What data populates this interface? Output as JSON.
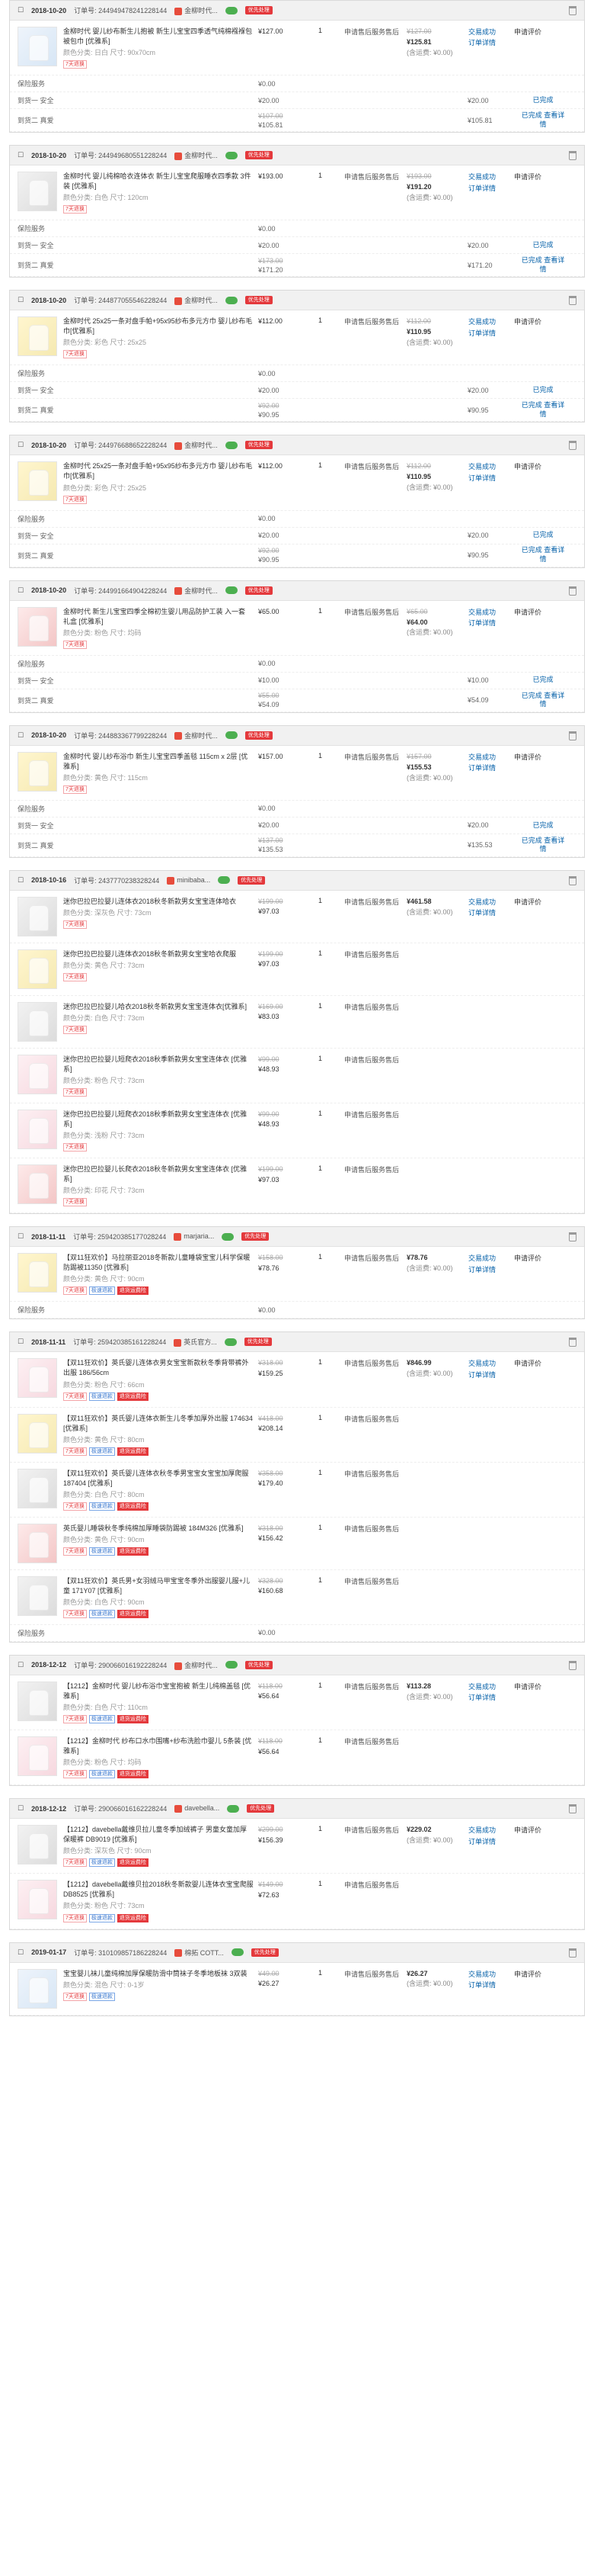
{
  "labels": {
    "order_no": "订单号:",
    "shop": "金柳时代...",
    "service": "服务售后",
    "apply": "申请售后",
    "urgent": "优先处理",
    "trade_done": "交易成功",
    "order_detail": "订单详情",
    "review": "申请评价",
    "closed": "已完成",
    "view_detail": "查看详情",
    "total_prefix": "含运费: ¥0.00",
    "seal": "保险服务",
    "dismiss1": "到货一  安全",
    "dismiss2": "到货二  真爱"
  },
  "orders": [
    {
      "date": "2018-10-20",
      "no": "2449494782412281​44",
      "shop": "金柳时代...",
      "items": [
        {
          "title": "金柳时代 婴儿纱布新生儿抱被 新生儿宝宝四季透气纯棉襁褓包被包巾 [优雅系]",
          "spec": "颜色分类: 日白 尺寸: 90x70cm",
          "price": "¥127.00",
          "qty": "1",
          "pay_strike": "¥127.00",
          "pay": "¥125.81",
          "note": "(含运费: ¥0.00)",
          "thumb": "blue"
        }
      ],
      "summary": [
        {
          "label": "保险服务",
          "amt": "¥0.00",
          "right": ""
        },
        {
          "label": "到货一 安全",
          "amt": "¥20.00",
          "right": "¥20.00",
          "x": "已完成"
        },
        {
          "label": "到货二 真爱",
          "amt": "¥105.81",
          "amt_strike": "¥107.00",
          "right": "¥105.81",
          "x": "已完成 查看详情"
        }
      ]
    },
    {
      "date": "2018-10-20",
      "no": "244949680551228244",
      "shop": "金柳时代...",
      "items": [
        {
          "title": "金柳时代 婴儿纯棉哈衣连体衣 新生儿宝宝爬服睡衣四季款 3件装 [优雅系]",
          "spec": "颜色分类: 白色 尺寸: 120cm",
          "price": "¥193.00",
          "qty": "1",
          "pay_strike": "¥193.00",
          "pay": "¥191.20",
          "note": "(含运费: ¥0.00)",
          "thumb": "grey"
        }
      ],
      "summary": [
        {
          "label": "保险服务",
          "amt": "¥0.00",
          "right": ""
        },
        {
          "label": "到货一 安全",
          "amt": "¥20.00",
          "right": "¥20.00",
          "x": "已完成"
        },
        {
          "label": "到货二 真爱",
          "amt": "¥171.20",
          "amt_strike": "¥173.00",
          "right": "¥171.20",
          "x": "已完成 查看详情"
        }
      ]
    },
    {
      "date": "2018-10-20",
      "no": "244877055546228244",
      "shop": "金柳时代...",
      "items": [
        {
          "title": "金柳时代 25x25一条对盘手帕+95x95纱布多元方巾 婴儿纱布毛巾[优雅系]",
          "spec": "颜色分类: 彩色 尺寸: 25x25",
          "price": "¥112.00",
          "qty": "1",
          "pay_strike": "¥112.00",
          "pay": "¥110.95",
          "note": "(含运费: ¥0.00)",
          "thumb": "yellow"
        }
      ],
      "summary": [
        {
          "label": "保险服务",
          "amt": "¥0.00",
          "right": ""
        },
        {
          "label": "到货一 安全",
          "amt": "¥20.00",
          "right": "¥20.00",
          "x": "已完成"
        },
        {
          "label": "到货二 真爱",
          "amt": "¥90.95",
          "amt_strike": "¥92.00",
          "right": "¥90.95",
          "x": "已完成 查看详情"
        }
      ]
    },
    {
      "date": "2018-10-20",
      "no": "244976688652228244",
      "shop": "金柳时代...",
      "items": [
        {
          "title": "金柳时代 25x25一条对盘手帕+95x95纱布多元方巾 婴儿纱布毛巾[优雅系]",
          "spec": "颜色分类: 彩色 尺寸: 25x25",
          "price": "¥112.00",
          "qty": "1",
          "pay_strike": "¥112.00",
          "pay": "¥110.95",
          "note": "(含运费: ¥0.00)",
          "thumb": "yellow"
        }
      ],
      "summary": [
        {
          "label": "保险服务",
          "amt": "¥0.00",
          "right": ""
        },
        {
          "label": "到货一 安全",
          "amt": "¥20.00",
          "right": "¥20.00",
          "x": "已完成"
        },
        {
          "label": "到货二 真爱",
          "amt": "¥90.95",
          "amt_strike": "¥92.00",
          "right": "¥90.95",
          "x": "已完成 查看详情"
        }
      ]
    },
    {
      "date": "2018-10-20",
      "no": "244991664904228244",
      "shop": "金柳时代...",
      "items": [
        {
          "title": "金柳时代 新生儿宝宝四季全棉初生婴儿用品防护工装 入一套 礼盒 [优雅系]",
          "spec": "颜色分类: 粉色 尺寸: 均码",
          "price": "¥65.00",
          "qty": "1",
          "pay_strike": "¥65.00",
          "pay": "¥64.00",
          "note": "(含运费: ¥0.00)",
          "thumb": "red"
        }
      ],
      "summary": [
        {
          "label": "保险服务",
          "amt": "¥0.00",
          "right": ""
        },
        {
          "label": "到货一 安全",
          "amt": "¥10.00",
          "right": "¥10.00",
          "x": "已完成"
        },
        {
          "label": "到货二 真爱",
          "amt": "¥54.09",
          "amt_strike": "¥55.00",
          "right": "¥54.09",
          "x": "已完成 查看详情"
        }
      ]
    },
    {
      "date": "2018-10-20",
      "no": "244883367799228244",
      "shop": "金柳时代...",
      "items": [
        {
          "title": "金柳时代 婴儿纱布浴巾 新生儿宝宝四季盖毯 115cm x 2层 [优雅系]",
          "spec": "颜色分类: 黄色 尺寸: 115cm",
          "price": "¥157.00",
          "qty": "1",
          "pay_strike": "¥157.00",
          "pay": "¥155.53",
          "note": "(含运费: ¥0.00)",
          "thumb": "yellow"
        }
      ],
      "summary": [
        {
          "label": "保险服务",
          "amt": "¥0.00",
          "right": ""
        },
        {
          "label": "到货一 安全",
          "amt": "¥20.00",
          "right": "¥20.00",
          "x": "已完成"
        },
        {
          "label": "到货二 真爱",
          "amt": "¥135.53",
          "amt_strike": "¥137.00",
          "right": "¥135.53",
          "x": "已完成 查看详情"
        }
      ]
    },
    {
      "date": "2018-10-16",
      "no": "2437770238328244",
      "shop": "minibaba...",
      "items": [
        {
          "title": "迷你巴拉巴拉婴儿连体衣2018秋冬新款男女宝宝连体哈衣",
          "spec": "颜色分类: 深灰色 尺寸: 73cm",
          "price": "¥97.03",
          "strike": "¥199.00",
          "qty": "1",
          "pay": "¥461.58",
          "note": "(含运费: ¥0.00)",
          "thumb": "grey"
        },
        {
          "title": "迷你巴拉巴拉婴儿连体衣2018秋冬新款男女宝宝哈衣爬服",
          "spec": "颜色分类: 黄色 尺寸: 73cm",
          "price": "¥97.03",
          "strike": "¥199.00",
          "qty": "1",
          "thumb": "yellow"
        },
        {
          "title": "迷你巴拉巴拉婴儿哈衣2018秋冬新款男女宝宝连体衣[优雅系]",
          "spec": "颜色分类: 白色 尺寸: 73cm",
          "price": "¥83.03",
          "strike": "¥169.00",
          "qty": "1",
          "thumb": "grey"
        },
        {
          "title": "迷你巴拉巴拉婴儿短爬衣2018秋季新款男女宝宝连体衣 [优雅系]",
          "spec": "颜色分类: 粉色 尺寸: 73cm",
          "price": "¥48.93",
          "strike": "¥99.00",
          "qty": "1",
          "thumb": "pink"
        },
        {
          "title": "迷你巴拉巴拉婴儿短爬衣2018秋季新款男女宝宝连体衣 [优雅系]",
          "spec": "颜色分类: 浅粉 尺寸: 73cm",
          "price": "¥48.93",
          "strike": "¥99.00",
          "qty": "1",
          "thumb": "pink"
        },
        {
          "title": "迷你巴拉巴拉婴儿长爬衣2018秋冬新款男女宝宝连体衣 [优雅系]",
          "spec": "颜色分类: 印花 尺寸: 73cm",
          "price": "¥97.03",
          "strike": "¥199.00",
          "qty": "1",
          "thumb": "red"
        }
      ],
      "summary": []
    },
    {
      "date": "2018-11-11",
      "no": "259420385177028244",
      "shop": "marjaria...",
      "items": [
        {
          "title": "【双11狂欢价】马拉丽亚2018冬新款儿童睡袋宝宝儿科学保暖防踢被11350 [优雅系]",
          "spec": "颜色分类: 黄色 尺寸: 90cm",
          "price": "¥78.76",
          "strike": "¥158.00",
          "qty": "1",
          "pay": "¥78.76",
          "note": "(含运费: ¥0.00)",
          "thumb": "yellow",
          "tags": [
            "7天退换",
            "极速退款",
            "退货运费险"
          ]
        }
      ],
      "summary": [
        {
          "label": "保险服务",
          "amt": "¥0.00",
          "right": ""
        }
      ]
    },
    {
      "date": "2018-11-11",
      "no": "259420385161228244",
      "shop": "英氏官方...",
      "items": [
        {
          "title": "【双11狂欢价】英氏婴儿连体衣男女宝宝新款秋冬季背带裤外出服 186/56cm",
          "spec": "颜色分类: 粉色 尺寸: 66cm",
          "price": "¥159.25",
          "strike": "¥318.00",
          "qty": "1",
          "pay": "¥846.99",
          "note": "(含运费: ¥0.00)",
          "thumb": "pink",
          "tags": [
            "7天退换",
            "极速退款",
            "退货运费险"
          ]
        },
        {
          "title": "【双11狂欢价】英氏婴儿连体衣新生儿冬季加厚外出服 174634 [优雅系]",
          "spec": "颜色分类: 黄色 尺寸: 80cm",
          "price": "¥208.14",
          "strike": "¥418.00",
          "qty": "1",
          "thumb": "yellow",
          "tags": [
            "7天退换",
            "极速退款",
            "退货运费险"
          ]
        },
        {
          "title": "【双11狂欢价】英氏婴儿连体衣秋冬季男宝宝女宝宝加厚爬服 187404 [优雅系]",
          "spec": "颜色分类: 白色 尺寸: 80cm",
          "price": "¥179.40",
          "strike": "¥358.00",
          "qty": "1",
          "thumb": "grey",
          "tags": [
            "7天退换",
            "极速退款",
            "退货运费险"
          ]
        },
        {
          "title": "英氏婴儿睡袋秋冬季纯棉加厚睡袋防踢被 184M326 [优雅系]",
          "spec": "颜色分类: 黄色 尺寸: 90cm",
          "price": "¥156.42",
          "strike": "¥318.00",
          "qty": "1",
          "thumb": "red",
          "tags": [
            "7天退换",
            "极速退款",
            "退货运费险"
          ]
        },
        {
          "title": "【双11狂欢价】英氏男+女羽绒马甲宝宝冬季外出服婴儿服+儿童 171Y07 [优雅系]",
          "spec": "颜色分类: 白色 尺寸: 90cm",
          "price": "¥160.68",
          "strike": "¥328.00",
          "qty": "1",
          "thumb": "grey",
          "tags": [
            "7天退换",
            "极速退款",
            "退货运费险"
          ]
        }
      ],
      "summary": [
        {
          "label": "保险服务",
          "amt": "¥0.00",
          "right": ""
        }
      ]
    },
    {
      "date": "2018-12-12",
      "no": "290066016192228244",
      "shop": "金柳时代...",
      "items": [
        {
          "title": "【1212】金柳时代 婴儿纱布浴巾宝宝抱被 新生儿纯棉盖毯 [优雅系]",
          "spec": "颜色分类: 白色 尺寸: 110cm",
          "price": "¥56.64",
          "strike": "¥118.00",
          "qty": "1",
          "pay": "¥113.28",
          "note": "(含运费: ¥0.00)",
          "thumb": "grey",
          "tags": [
            "7天退换",
            "极速退款",
            "退货运费险"
          ]
        },
        {
          "title": "【1212】金柳时代 纱布口水巾围嘴+纱布洗脸巾婴儿 5条装 [优雅系]",
          "spec": "颜色分类: 粉色 尺寸: 均码",
          "price": "¥56.64",
          "strike": "¥118.00",
          "qty": "1",
          "thumb": "pink",
          "tags": [
            "7天退换",
            "极速退款",
            "退货运费险"
          ]
        }
      ],
      "summary": []
    },
    {
      "date": "2018-12-12",
      "no": "290066016162228244",
      "shop": "davebella...",
      "items": [
        {
          "title": "【1212】davebella戴维贝拉儿童冬季加绒裤子 男童女童加厚保暖裤 DB9019 [优雅系]",
          "spec": "颜色分类: 深灰色 尺寸: 90cm",
          "price": "¥156.39",
          "strike": "¥299.00",
          "qty": "1",
          "pay": "¥229.02",
          "note": "(含运费: ¥0.00)",
          "thumb": "grey",
          "tags": [
            "7天退换",
            "极速退款",
            "退货运费险"
          ]
        },
        {
          "title": "【1212】davebella戴维贝拉2018秋冬新款婴儿连体衣宝宝爬服 DB8525 [优雅系]",
          "spec": "颜色分类: 粉色 尺寸: 73cm",
          "price": "¥72.63",
          "strike": "¥149.00",
          "qty": "1",
          "thumb": "pink",
          "tags": [
            "7天退换",
            "极速退款",
            "退货运费险"
          ]
        }
      ],
      "summary": []
    },
    {
      "date": "2019-01-17",
      "no": "3101098571862​28244",
      "shop": "棉拓 COTT...",
      "items": [
        {
          "title": "宝宝婴儿袜儿童纯棉加厚保暖防滑中筒袜子冬季地板袜 3双装",
          "spec": "颜色分类: 混色 尺寸: 0-1岁",
          "price": "¥26.27",
          "strike": "¥49.00",
          "qty": "1",
          "pay": "¥26.27",
          "note": "(含运费: ¥0.00)",
          "thumb": "blue",
          "tags": [
            "7天退换",
            "极速退款"
          ]
        }
      ],
      "summary": []
    }
  ]
}
